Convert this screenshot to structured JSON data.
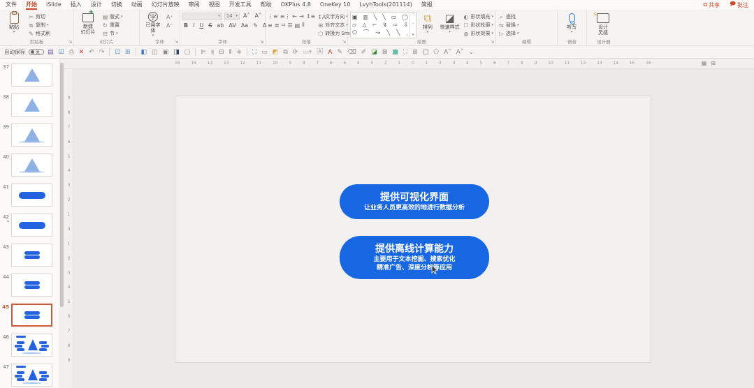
{
  "menubar": {
    "tabs": [
      "文件",
      "开始",
      "iSlide",
      "插入",
      "设计",
      "切换",
      "动画",
      "幻灯片放映",
      "审阅",
      "视图",
      "开发工具",
      "帮助",
      "OKPlus 4.8",
      "OneKey 10",
      "LvyhTools(201114)",
      "简报"
    ],
    "active_tab": "开始",
    "share_label": "共享",
    "comments_label": "批注",
    "accent_color": "#C8492C"
  },
  "ribbon": {
    "clipboard": {
      "label": "剪贴板",
      "paste": "粘贴",
      "cut": "剪切",
      "copy": "复制",
      "format_painter": "格式刷"
    },
    "slides": {
      "label": "幻灯片",
      "new_slide": "新建\n幻灯片",
      "layout": "版式",
      "reset": "重置",
      "section": "节"
    },
    "used_font": {
      "label": "字体",
      "button": "已用字\n体"
    },
    "font": {
      "label": "字体",
      "size_value": "14",
      "buttons": [
        "B",
        "I",
        "U",
        "S",
        "ab",
        "AV",
        "Aa",
        "✎",
        "A"
      ]
    },
    "paragraph": {
      "label": "段落",
      "row1_icons": [
        "⋮≡",
        "≡⋮",
        "⇤",
        "⇥",
        "↕≡"
      ],
      "row2_icons": [
        "≡",
        "≣",
        "⫤",
        "☰",
        "▤",
        "⫴"
      ],
      "text_direction": "文字方向",
      "align_text": "对齐文本",
      "smartart": "转换为 SmartArt"
    },
    "drawing": {
      "label": "绘图",
      "gallery_rows": [
        [
          "▣",
          "▥",
          "╲",
          "╲",
          "▭",
          "◯"
        ],
        [
          "▱",
          "△",
          "⌐",
          "↯",
          "⇨",
          "⇩"
        ],
        [
          "⬠",
          "⌒",
          "↝",
          "╲",
          "╲",
          "˯"
        ]
      ],
      "arrange": "排列",
      "quick_styles": "快速样式",
      "shape_fill": "形状填充",
      "shape_outline": "形状轮廓",
      "shape_effects": "形状效果"
    },
    "editing": {
      "label": "编辑",
      "find": "查找",
      "replace": "替换",
      "select": "选择"
    },
    "voice": {
      "label": "语音",
      "dictate": "听写"
    },
    "designer": {
      "label": "设计器",
      "design_ideas": "设计\n灵感"
    }
  },
  "qat": {
    "autosave_label": "自动保存",
    "autosave_state": "关",
    "icons": [
      {
        "name": "save-icon",
        "glyph": "▤",
        "color": "#6B5CA8"
      },
      {
        "name": "save-status-icon",
        "glyph": "☑",
        "color": "#4472C4"
      },
      {
        "name": "print-icon",
        "glyph": "⎙",
        "color": "#8a8886"
      },
      {
        "name": "close-red-icon",
        "glyph": "✕",
        "color": "#C0392B"
      },
      {
        "name": "undo-icon",
        "glyph": "↶",
        "color": "#8a8886"
      },
      {
        "name": "redo-icon",
        "glyph": "↷",
        "color": "#8a8886"
      },
      {
        "name": "sep",
        "glyph": "|",
        "color": "#D8D5D1"
      },
      {
        "name": "slideshow-from-start-icon",
        "glyph": "⊡",
        "color": "#6a88b5"
      },
      {
        "name": "slideshow-current-icon",
        "glyph": "⊞",
        "color": "#6a88b5"
      },
      {
        "name": "sep",
        "glyph": "|",
        "color": "#D8D5D1"
      },
      {
        "name": "normal-view-icon",
        "glyph": "◧",
        "color": "#4472C4"
      },
      {
        "name": "sorter-view-icon",
        "glyph": "◫",
        "color": "#8a8886"
      },
      {
        "name": "new-slide-icon",
        "glyph": "▣",
        "color": "#8a8886"
      },
      {
        "name": "theme-colors-icon",
        "glyph": "◨",
        "color": "#33425B"
      },
      {
        "name": "textbox-icon",
        "glyph": "▢",
        "color": "#8a8886"
      },
      {
        "name": "sep",
        "glyph": "|",
        "color": "#D8D5D1"
      },
      {
        "name": "align-left-icon",
        "glyph": "⊫",
        "color": "#8a8886"
      },
      {
        "name": "align-center-h-icon",
        "glyph": "⫵",
        "color": "#8a8886"
      },
      {
        "name": "align-middle-icon",
        "glyph": "⊟",
        "color": "#8a8886"
      },
      {
        "name": "distribute-h-icon",
        "glyph": "⫴",
        "color": "#8a8886"
      },
      {
        "name": "distribute-v-icon",
        "glyph": "≑",
        "color": "#8a8886"
      },
      {
        "name": "sep",
        "glyph": "|",
        "color": "#D8D5D1"
      },
      {
        "name": "picture-icon",
        "glyph": "⛶",
        "color": "#4a7ebb"
      },
      {
        "name": "textframe-icon",
        "glyph": "▭",
        "color": "#8a8886"
      },
      {
        "name": "fill-color-icon",
        "glyph": "◩",
        "color": "#D9A44A"
      },
      {
        "name": "group-icon",
        "glyph": "⧉",
        "color": "#8a8886"
      },
      {
        "name": "rotate-icon",
        "glyph": "⟳",
        "color": "#8a8886"
      },
      {
        "name": "combo-blank",
        "glyph": "▭▾",
        "color": "#b8b5b2"
      },
      {
        "name": "language-icon",
        "glyph": "🄰",
        "color": "#8a8886"
      },
      {
        "name": "font-color-icon",
        "glyph": "A",
        "color": "#C0392B"
      },
      {
        "name": "pen-icon",
        "glyph": "✎",
        "color": "#8a8886"
      },
      {
        "name": "eraser-icon",
        "glyph": "⌫",
        "color": "#8a8886"
      },
      {
        "name": "highlight-icon",
        "glyph": "✐",
        "color": "#8a8886"
      },
      {
        "name": "chart-icon",
        "glyph": "◪",
        "color": "#44883E"
      },
      {
        "name": "crop-icon",
        "glyph": "⊠",
        "color": "#8a8886"
      },
      {
        "name": "swatch-icon",
        "glyph": "▩",
        "color": "#2E9A87"
      },
      {
        "name": "selection-icon",
        "glyph": "⛶",
        "color": "#8a8886"
      },
      {
        "name": "table-icon",
        "glyph": "⊞",
        "color": "#8a8886"
      },
      {
        "name": "square-icon",
        "glyph": "□",
        "color": "#44546A"
      },
      {
        "name": "shape-icon",
        "glyph": "⬠",
        "color": "#8a8886"
      },
      {
        "name": "font-grow-icon",
        "glyph": "A˄",
        "color": "#8a8886"
      },
      {
        "name": "font-shrink-icon",
        "glyph": "A˅",
        "color": "#8a8886"
      },
      {
        "name": "more-icon",
        "glyph": "⌄",
        "color": "#8a8886"
      }
    ]
  },
  "slide_panel": {
    "selected": 45,
    "slides": [
      {
        "num": 37,
        "type": "triangle"
      },
      {
        "num": 38,
        "type": "triangle"
      },
      {
        "num": 39,
        "type": "triangle-shadow"
      },
      {
        "num": 40,
        "type": "triangle-shadow"
      },
      {
        "num": 41,
        "type": "pill"
      },
      {
        "num": 42,
        "type": "pill",
        "modified": true
      },
      {
        "num": 43,
        "type": "pills2"
      },
      {
        "num": 44,
        "type": "pills2"
      },
      {
        "num": 45,
        "type": "pills2"
      },
      {
        "num": 46,
        "type": "pyramid-diagram"
      },
      {
        "num": 47,
        "type": "pyramid-diagram"
      }
    ]
  },
  "rulers": {
    "h": [
      "16",
      "15",
      "14",
      "13",
      "12",
      "11",
      "10",
      "9",
      "8",
      "7",
      "6",
      "5",
      "4",
      "3",
      "2",
      "1",
      "0",
      "1",
      "2",
      "3",
      "4",
      "5",
      "6",
      "7",
      "8",
      "9",
      "10",
      "11",
      "12",
      "13",
      "14",
      "15",
      "16"
    ],
    "v": [
      "9",
      "8",
      "7",
      "6",
      "5",
      "4",
      "3",
      "2",
      "1",
      "0",
      "1",
      "2",
      "3",
      "4",
      "5",
      "6",
      "7",
      "8",
      "9"
    ]
  },
  "slide_canvas": {
    "shape_color": "#1766E2",
    "shapes": [
      {
        "title": "提供可视化界面",
        "lines": [
          "让业务人员更高效的地进行数据分析"
        ]
      },
      {
        "title": "提供离线计算能力",
        "lines": [
          "主要用于文本挖掘、搜索优化",
          "精准广告、深度分析等应用"
        ]
      }
    ]
  }
}
